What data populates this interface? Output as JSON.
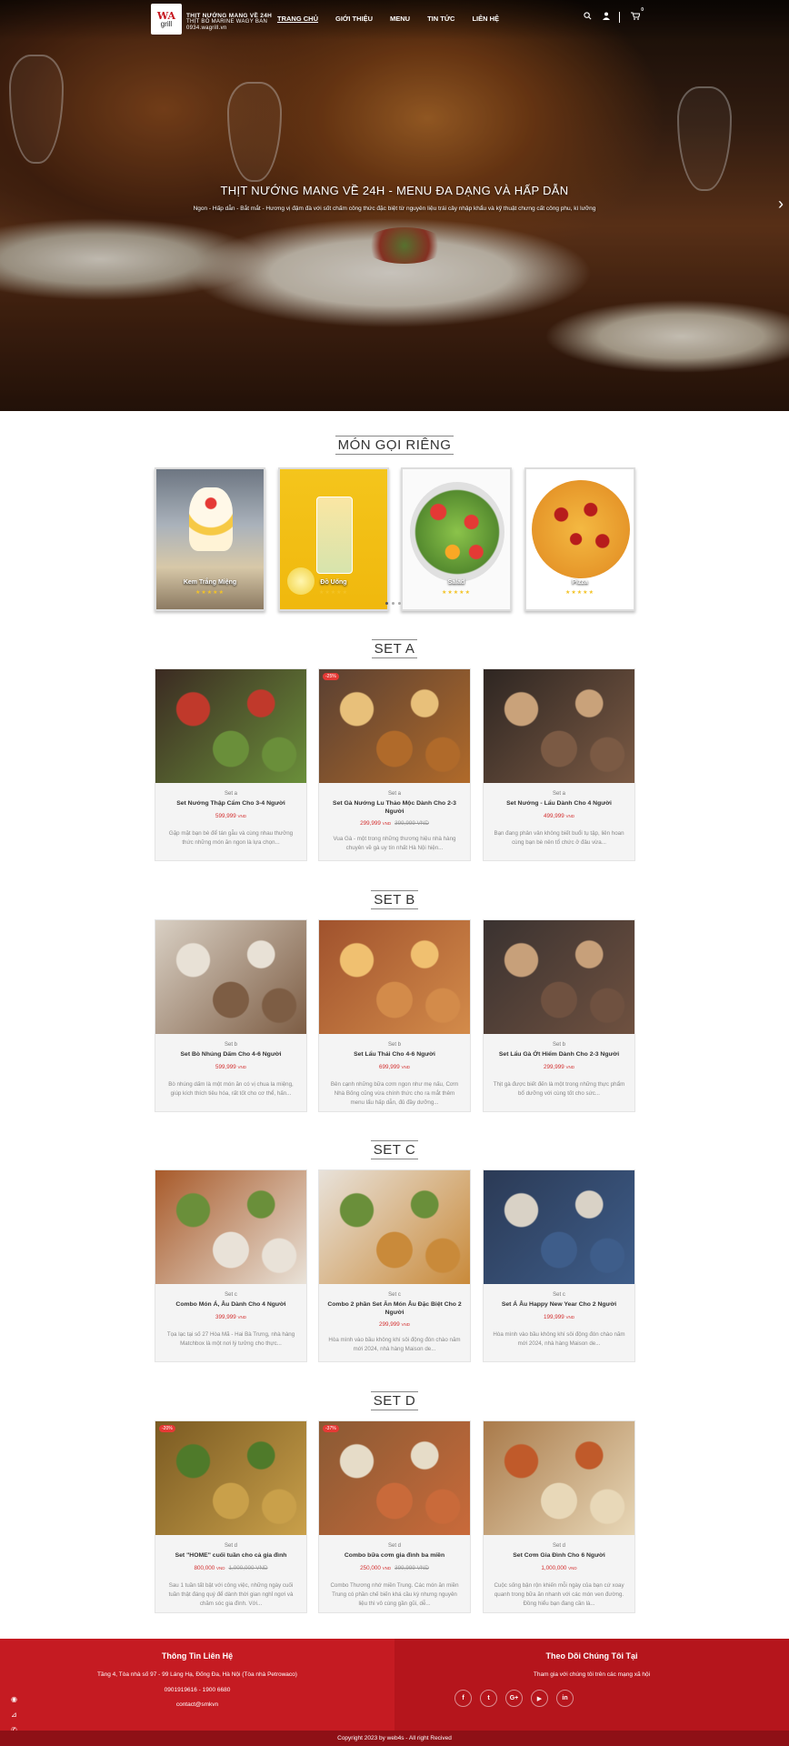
{
  "header": {
    "logo_text_1": "WA",
    "logo_text_2": "grill",
    "tagline_1": "THỊT NƯỚNG MANG VỀ 24H",
    "tagline_2": "THỊT BÒ MARINE WAGY BAN",
    "tagline_3": "0934.wagrill.vn",
    "nav": [
      "TRANG CHỦ",
      "GIỚI THIỆU",
      "MENU",
      "TIN TỨC",
      "LIÊN HỆ"
    ],
    "cart_count": "0"
  },
  "hero": {
    "title": "THỊT NƯỚNG MANG VỀ 24H - MENU ĐA DẠNG VÀ HẤP DẪN",
    "subtitle": "Ngon - Hấp dẫn - Bắt mắt - Hương vị đậm đà với sốt chấm công thức đặc biệt từ nguyên liệu trái cây nhập khẩu và kỹ thuật chưng cất công phu, kì lưỡng"
  },
  "categories": {
    "title": "MÓN GỌI RIÊNG",
    "items": [
      {
        "label": "Kem Trắng Miệng",
        "stars": "★★★★★"
      },
      {
        "label": "Đồ Uống",
        "stars": "★★★★★"
      },
      {
        "label": "Salad",
        "stars": "★★★★★"
      },
      {
        "label": "Pizza",
        "stars": "★★★★★"
      }
    ]
  },
  "sections": [
    {
      "title": "SET A",
      "cards": [
        {
          "cat": "Set a",
          "name": "Set Nướng Thập Cẩm Cho 3-4 Người",
          "price": "599,999",
          "unit": "VND",
          "old": "",
          "desc": "Gặp mặt bạn bè để tán gẫu và cùng nhau thưởng thức những món ăn ngon là lựa chọn...",
          "badge": ""
        },
        {
          "cat": "Set a",
          "name": "Set Gà Nướng Lu Thảo Mộc Dành Cho 2-3 Người",
          "price": "299,999",
          "unit": "VND",
          "old": "399,999 VND",
          "desc": "Vua Gà - một trong những thương hiệu nhà hàng chuyên về gà uy tín nhất Hà Nội hiện...",
          "badge": "-25%"
        },
        {
          "cat": "Set a",
          "name": "Set Nướng - Lẩu Dành Cho 4 Người",
          "price": "499,999",
          "unit": "VND",
          "old": "",
          "desc": "Bạn đang phân vân không biết buổi tụ tập, liên hoan cùng bạn bè nên tổ chức ở đâu vừa...",
          "badge": ""
        }
      ]
    },
    {
      "title": "SET B",
      "cards": [
        {
          "cat": "Set b",
          "name": "Set Bò Nhúng Dấm Cho 4-6 Người",
          "price": "599,999",
          "unit": "VND",
          "old": "",
          "desc": "Bò nhúng dấm là một món ăn có vị chua la miệng, giúp kích thích tiêu hóa, rất tốt cho cơ thể, hấn...",
          "badge": ""
        },
        {
          "cat": "Set b",
          "name": "Set Lẩu Thái Cho 4-6 Người",
          "price": "699,999",
          "unit": "VND",
          "old": "",
          "desc": "Bên cạnh những bữa cơm ngon như mẹ nấu, Cơm Nhà Bống cũng vừa chính thức cho ra mắt thêm menu lẩu hấp dẫn, đủ đầy dưỡng...",
          "badge": ""
        },
        {
          "cat": "Set b",
          "name": "Set Lẩu Gà Ớt Hiểm Dành Cho 2-3 Người",
          "price": "299,999",
          "unit": "VND",
          "old": "",
          "desc": "Thịt gà được biết đến là một trong những thực phẩm bổ dưỡng với cùng tốt cho sức...",
          "badge": ""
        }
      ]
    },
    {
      "title": "SET C",
      "cards": [
        {
          "cat": "Set c",
          "name": "Combo Món Á, Âu Dành Cho 4 Người",
          "price": "399,999",
          "unit": "VND",
          "old": "",
          "desc": "Tọa lạc tại số 27 Hòa Mã - Hai Bà Trưng, nhà hàng Matchbox là một nơi lý tưởng cho thực...",
          "badge": ""
        },
        {
          "cat": "Set c",
          "name": "Combo 2 phần Set Ăn Món Âu Đặc Biệt Cho 2 Người",
          "price": "299,999",
          "unit": "VND",
          "old": "",
          "desc": "Hòa mình vào bầu không khí sôi động đón chào năm mới 2024, nhà hàng Maison de...",
          "badge": ""
        },
        {
          "cat": "Set c",
          "name": "Set Á Âu Happy New Year Cho 2 Người",
          "price": "199,999",
          "unit": "VND",
          "old": "",
          "desc": "Hòa mình vào bầu không khí sôi động đón chào năm mới 2024, nhà hàng Maison de...",
          "badge": ""
        }
      ]
    },
    {
      "title": "SET D",
      "cards": [
        {
          "cat": "Set d",
          "name": "Set \"HOME\" cuối tuần cho cả gia đình",
          "price": "800,000",
          "unit": "VND",
          "old": "1,000,000 VND",
          "desc": "Sau 1 tuần tất bật với công việc, những ngày cuối tuần thật đáng quý để dành thời gian nghỉ ngơi và chăm sóc gia đình. Với...",
          "badge": "-20%"
        },
        {
          "cat": "Set d",
          "name": "Combo bữa cơm gia đình ba miền",
          "price": "250,000",
          "unit": "VND",
          "old": "399,999 VND",
          "desc": "Combo Thương nhớ miền Trung. Các món ăn miền Trung có phần chế biến khá cầu kỳ nhưng nguyên liệu thì vô cùng gần gũi, dễ...",
          "badge": "-37%"
        },
        {
          "cat": "Set d",
          "name": "Set Cơm Gia Đình Cho 6 Người",
          "price": "1,000,000",
          "unit": "VND",
          "old": "",
          "desc": "Cuộc sống bận rộn khiến mỗi ngày của bạn cứ xoay quanh trong bữa ăn nhanh với các món ven đường. Đồng hiểu bạn đang cần là...",
          "badge": ""
        }
      ]
    }
  ],
  "footer": {
    "left_title": "Thông Tin Liên Hệ",
    "address": "Tầng 4, Tòa nhà số 97 - 99 Láng Hạ, Đống Đa, Hà Nội (Tòa nhà Petrowaco)",
    "phone": "0901919616 - 1900 6680",
    "email": "contact@smkvn",
    "right_title": "Theo Dõi Chúng Tôi Tại",
    "right_sub": "Tham gia với chúng tôi trên các mạng xã hội",
    "social": [
      "f",
      "t",
      "G+",
      "▶",
      "in"
    ],
    "copyright": "Copyright 2023 by web4s - All right Recived"
  },
  "colors": {
    "brand": "#c51b22",
    "price": "#d32f2f",
    "star": "#f3c326"
  }
}
